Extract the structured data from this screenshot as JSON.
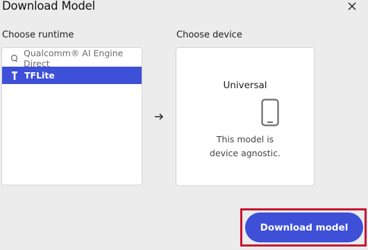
{
  "dialog": {
    "title": "Download Model",
    "close_icon": "close-icon"
  },
  "runtime": {
    "label": "Choose runtime",
    "items": [
      {
        "label": "Qualcomm® AI Engine Direct",
        "icon": "qualcomm-icon",
        "selected": false
      },
      {
        "label": "TFLite",
        "icon": "tflite-icon",
        "selected": true
      }
    ]
  },
  "arrow_icon": "arrow-right-icon",
  "device": {
    "label": "Choose device",
    "name": "Universal",
    "icon": "phone-icon",
    "description_line1": "This model is",
    "description_line2": "device agnostic."
  },
  "actions": {
    "download_label": "Download model"
  },
  "colors": {
    "accent": "#3e4fd8",
    "highlight_border": "#c8102e",
    "background": "#ececec"
  }
}
